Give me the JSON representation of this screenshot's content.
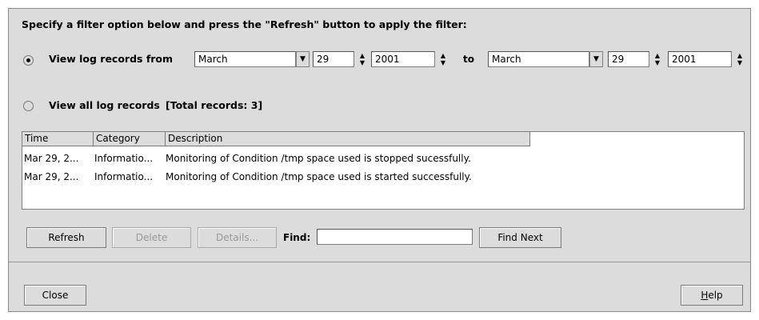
{
  "instruction": "Specify a filter option below and press the \"Refresh\" button to apply the filter:",
  "filter": {
    "range_label": "View log records from",
    "from": {
      "month": "March",
      "day": "29",
      "year": "2001"
    },
    "to_label": "to",
    "to": {
      "month": "March",
      "day": "29",
      "year": "2001"
    },
    "all_label": "View all log records",
    "total_label": "[Total records: 3]",
    "selected": "range"
  },
  "table": {
    "columns": [
      "Time",
      "Category",
      "Description"
    ],
    "rows": [
      {
        "time": "Mar 29, 2...",
        "category": "Informatio...",
        "description": "Monitoring of Condition /tmp space used is stopped sucessfully."
      },
      {
        "time": "Mar 29, 2...",
        "category": "Informatio...",
        "description": "Monitoring of Condition /tmp space used is started successfully."
      }
    ]
  },
  "actions": {
    "refresh": "Refresh",
    "delete": "Delete",
    "details": "Details...",
    "find_label": "Find:",
    "find_value": "",
    "find_next": "Find Next"
  },
  "footer": {
    "close": "Close",
    "help": "Help"
  },
  "icons": {
    "dropdown": "chevron-down-icon",
    "spinner": "spinner-arrows-icon"
  }
}
